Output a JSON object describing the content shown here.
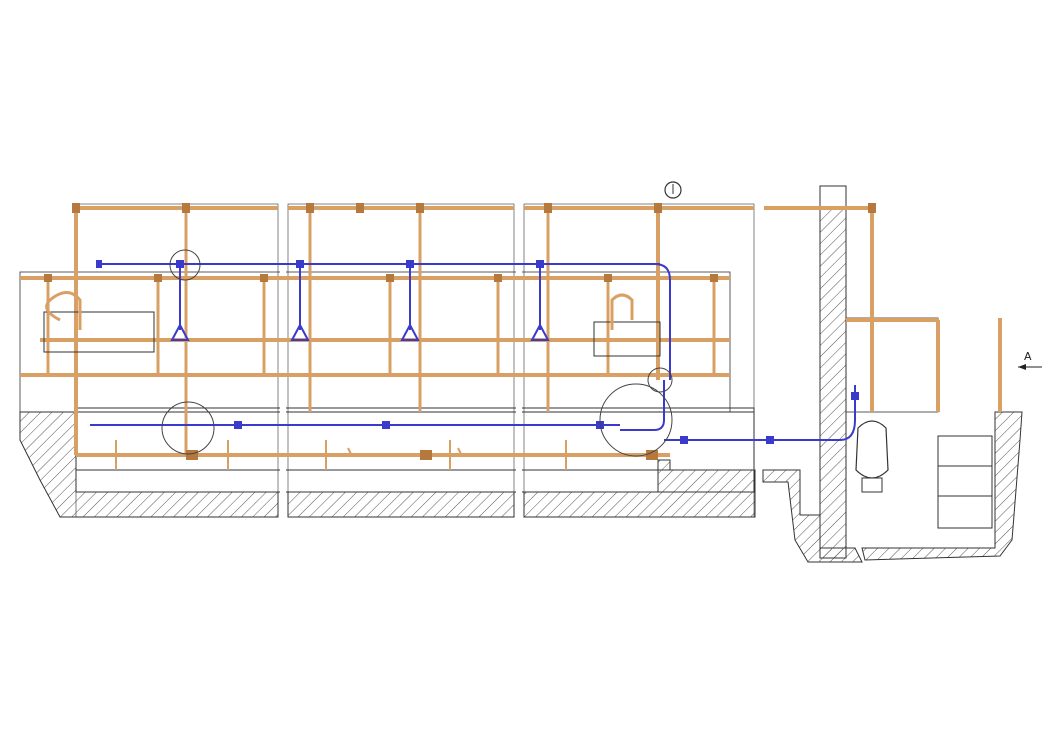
{
  "drawing": {
    "section_label": "A",
    "colors": {
      "background": "#ffffff",
      "outline": "#333333",
      "hatch": "#555555",
      "pipe_main": "#d9a066",
      "pipe_main_dark": "#b5783d",
      "pipe_secondary": "#3a3acc",
      "pipe_secondary_light": "#9a9ae8",
      "detail_circle": "#444444"
    }
  }
}
